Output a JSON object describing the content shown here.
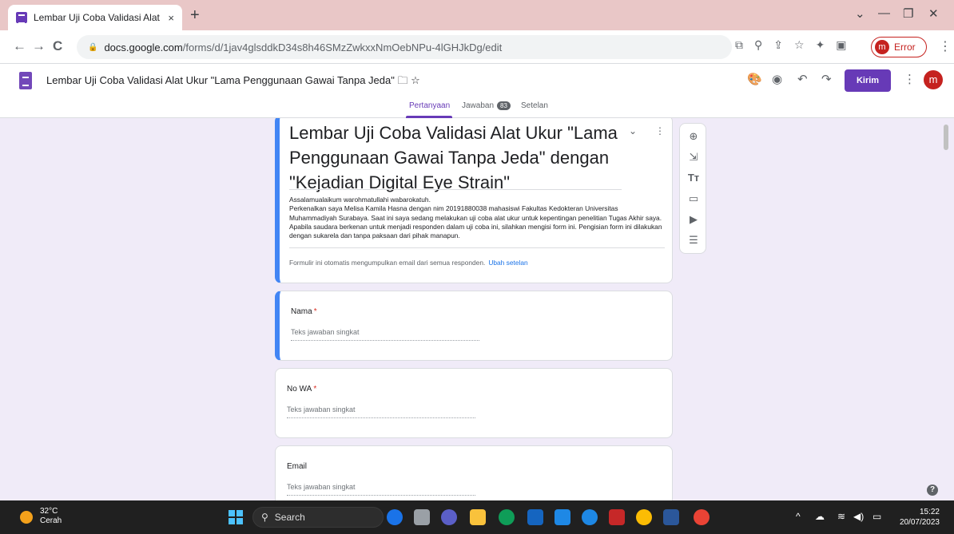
{
  "browser": {
    "tab_title": "Lembar Uji Coba Validasi Alat Uk",
    "tab_close": "×",
    "new_tab": "+",
    "url_host": "docs.google.com",
    "url_path": "/forms/d/1jav4glsddkD34s8h46SMzZwkxxNmOebNPu-4lGHJkDg/edit",
    "profile_initial": "m",
    "profile_status": "Error"
  },
  "forms_header": {
    "doc_title": "Lembar Uji Coba Validasi Alat Ukur \"Lama Penggunaan Gawai Tanpa Jeda\"",
    "send_label": "Kirim",
    "avatar_initial": "m",
    "tabs": [
      {
        "label": "Pertanyaan",
        "active": true
      },
      {
        "label": "Jawaban",
        "count": "83"
      },
      {
        "label": "Setelan"
      }
    ]
  },
  "form": {
    "title": "Lembar Uji Coba Validasi Alat Ukur \"Lama Penggunaan Gawai Tanpa Jeda\" dengan \"Kejadian Digital Eye Strain\"",
    "description": "Assalamualaikum warohmatullahi wabarokatuh.\nPerkenalkan saya Melisa Kamila Hasna dengan nim 20191880038 mahasiswi Fakultas Kedokteran Universitas Muhammadiyah Surabaya. Saat ini saya sedang melakukan uji coba alat ukur untuk kepentingan penelitian Tugas Akhir saya. Apabila saudara berkenan untuk menjadi responden dalam uji coba ini, silahkan mengisi form ini. Pengisian form ini dilakukan dengan sukarela dan tanpa paksaan dari pihak manapun.",
    "auto_email_note": "Formulir ini otomatis mengumpulkan email dari semua responden.",
    "change_settings_link": "Ubah setelan",
    "questions": [
      {
        "label": "Nama",
        "required": "*",
        "placeholder": "Teks jawaban singkat"
      },
      {
        "label": "No WA",
        "required": "*",
        "placeholder": "Teks jawaban singkat"
      },
      {
        "label": "Email",
        "required": "",
        "placeholder": "Teks jawaban singkat"
      }
    ]
  },
  "taskbar": {
    "temperature": "32°C",
    "weather": "Cerah",
    "search_label": "Search",
    "time": "15:22",
    "date": "20/07/2023"
  },
  "icons": {
    "help": "?"
  }
}
